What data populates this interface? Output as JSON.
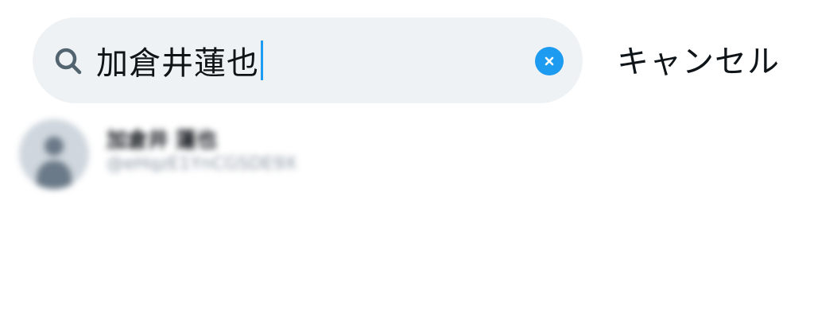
{
  "search": {
    "query": "加倉井蓮也",
    "cancel_label": "キャンセル",
    "accent_color": "#1d9bf0",
    "search_icon": "search-icon",
    "clear_icon": "clear-icon"
  },
  "results": [
    {
      "name": "加倉井 蓮也",
      "handle": "@eHqzE1YnCGSDE9X"
    }
  ]
}
